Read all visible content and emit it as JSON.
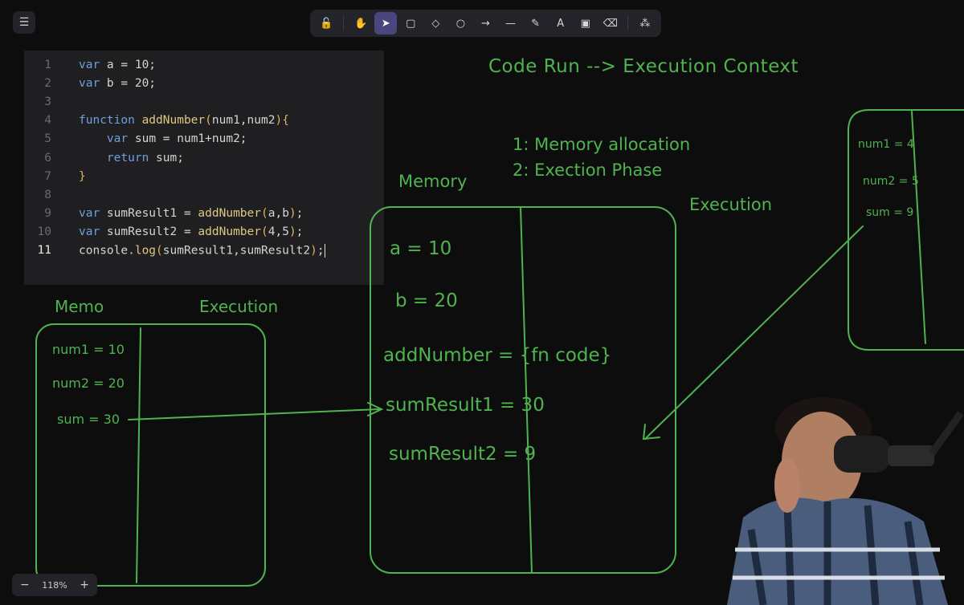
{
  "app": {
    "menu_icon": "hamburger-menu-icon"
  },
  "toolbar": {
    "tools": [
      {
        "name": "lock-tool",
        "glyph": "🔓"
      },
      {
        "name": "hand-tool",
        "glyph": "✋"
      },
      {
        "name": "selection-tool",
        "glyph": "➤",
        "active": true
      },
      {
        "name": "rectangle-tool",
        "glyph": "▢"
      },
      {
        "name": "diamond-tool",
        "glyph": "◇"
      },
      {
        "name": "ellipse-tool",
        "glyph": "○"
      },
      {
        "name": "arrow-tool",
        "glyph": "→"
      },
      {
        "name": "line-tool",
        "glyph": "—"
      },
      {
        "name": "pencil-tool",
        "glyph": "✎"
      },
      {
        "name": "text-tool",
        "glyph": "A"
      },
      {
        "name": "image-tool",
        "glyph": "▣"
      },
      {
        "name": "eraser-tool",
        "glyph": "⌫"
      },
      {
        "name": "more-tools",
        "glyph": "⁂"
      }
    ]
  },
  "editor": {
    "lines": [
      {
        "num": "1",
        "text": "var a = 10;"
      },
      {
        "num": "2",
        "text": "var b = 20;"
      },
      {
        "num": "3",
        "text": ""
      },
      {
        "num": "4",
        "text": "function addNumber(num1,num2){"
      },
      {
        "num": "5",
        "text": "    var sum = num1+num2;"
      },
      {
        "num": "6",
        "text": "    return sum;"
      },
      {
        "num": "7",
        "text": "}"
      },
      {
        "num": "8",
        "text": ""
      },
      {
        "num": "9",
        "text": "var sumResult1 = addNumber(a,b);"
      },
      {
        "num": "10",
        "text": "var sumResult2 = addNumber(4,5);"
      },
      {
        "num": "11",
        "text": "console.log(sumResult1,sumResult2);"
      }
    ],
    "current_line": "11"
  },
  "board": {
    "title": "Code Run --> Execution Context",
    "step1": "1: Memory allocation",
    "step2": "2: Exection Phase",
    "main_memory_label": "Memory",
    "main_execution_label": "Execution",
    "main_memory_entries": [
      "a = 10",
      "b = 20",
      "addNumber = {fn code}",
      "sumResult1 = 30",
      "sumResult2 = 9"
    ],
    "left_memory_label": "Memo",
    "left_execution_label": "Execution",
    "left_memory_entries": [
      "num1 = 10",
      "num2 = 20",
      "sum = 30"
    ],
    "right_memory_entries": [
      "num1 = 4",
      "num2 = 5",
      "sum = 9"
    ],
    "stroke_color": "#4fb34f"
  },
  "zoom": {
    "level": "118%",
    "minus": "−",
    "plus": "+"
  }
}
